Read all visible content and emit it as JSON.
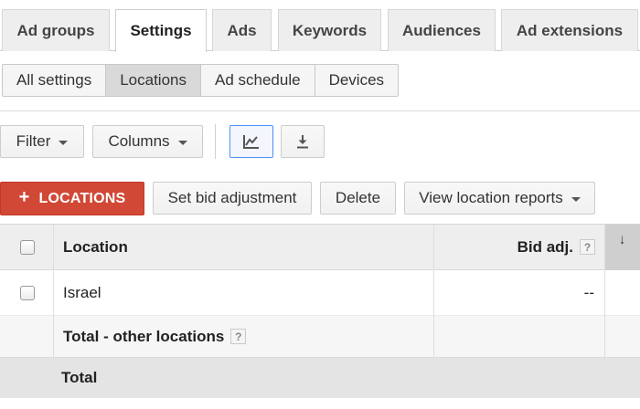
{
  "tabs": [
    {
      "label": "Ad groups"
    },
    {
      "label": "Settings"
    },
    {
      "label": "Ads"
    },
    {
      "label": "Keywords"
    },
    {
      "label": "Audiences"
    },
    {
      "label": "Ad extensions"
    }
  ],
  "active_tab": "Settings",
  "subtabs": [
    {
      "label": "All settings"
    },
    {
      "label": "Locations"
    },
    {
      "label": "Ad schedule"
    },
    {
      "label": "Devices"
    }
  ],
  "active_subtab": "Locations",
  "toolbar": {
    "filter_label": "Filter",
    "columns_label": "Columns",
    "chart_icon": "line-chart-icon",
    "download_icon": "download-icon"
  },
  "actions": {
    "add_locations_label": "LOCATIONS",
    "add_icon": "+",
    "set_bid_label": "Set bid adjustment",
    "delete_label": "Delete",
    "view_reports_label": "View location reports"
  },
  "table": {
    "headers": {
      "location": "Location",
      "bid_adj": "Bid adj.",
      "help": "?",
      "sort_icon": "↓"
    },
    "rows": [
      {
        "location": "Israel",
        "bid_adj": "--"
      }
    ],
    "other_locations": {
      "label": "Total - other locations",
      "help": "?"
    },
    "total": {
      "label": "Total"
    }
  },
  "colors": {
    "accent_red": "#d14836",
    "selected_border": "#4d90fe",
    "header_bg": "#eeeeee"
  }
}
